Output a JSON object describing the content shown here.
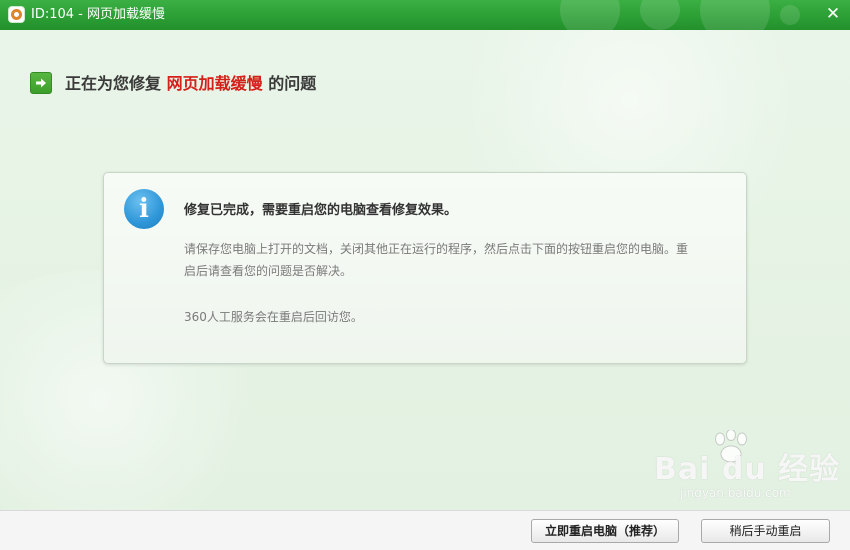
{
  "window": {
    "title": "ID:104 - 网页加载缓慢",
    "close_glyph": "✕",
    "app_icon": "lifebuoy-icon"
  },
  "status": {
    "icon": "arrow-right-icon",
    "prefix": "正在为您修复",
    "highlight": "网页加载缓慢",
    "suffix": "的问题",
    "highlight_color": "#d5201a"
  },
  "panel": {
    "icon": "info-icon",
    "icon_glyph": "i",
    "title": "修复已完成，需要重启您的电脑查看修复效果。",
    "body": "请保存您电脑上打开的文档，关闭其他正在运行的程序，然后点击下面的按钮重启您的电脑。重启后请查看您的问题是否解决。",
    "note": "360人工服务会在重启后回访您。"
  },
  "footer": {
    "restart_now_label": "立即重启电脑（推荐）",
    "restart_later_label": "稍后手动重启"
  },
  "watermark": {
    "brand": "Bai du 经验",
    "sub": "jingyan.baidu.com"
  },
  "colors": {
    "titlebar": "#2c9f35",
    "accent_green": "#3c9e2a",
    "info_blue": "#2e96d8"
  }
}
